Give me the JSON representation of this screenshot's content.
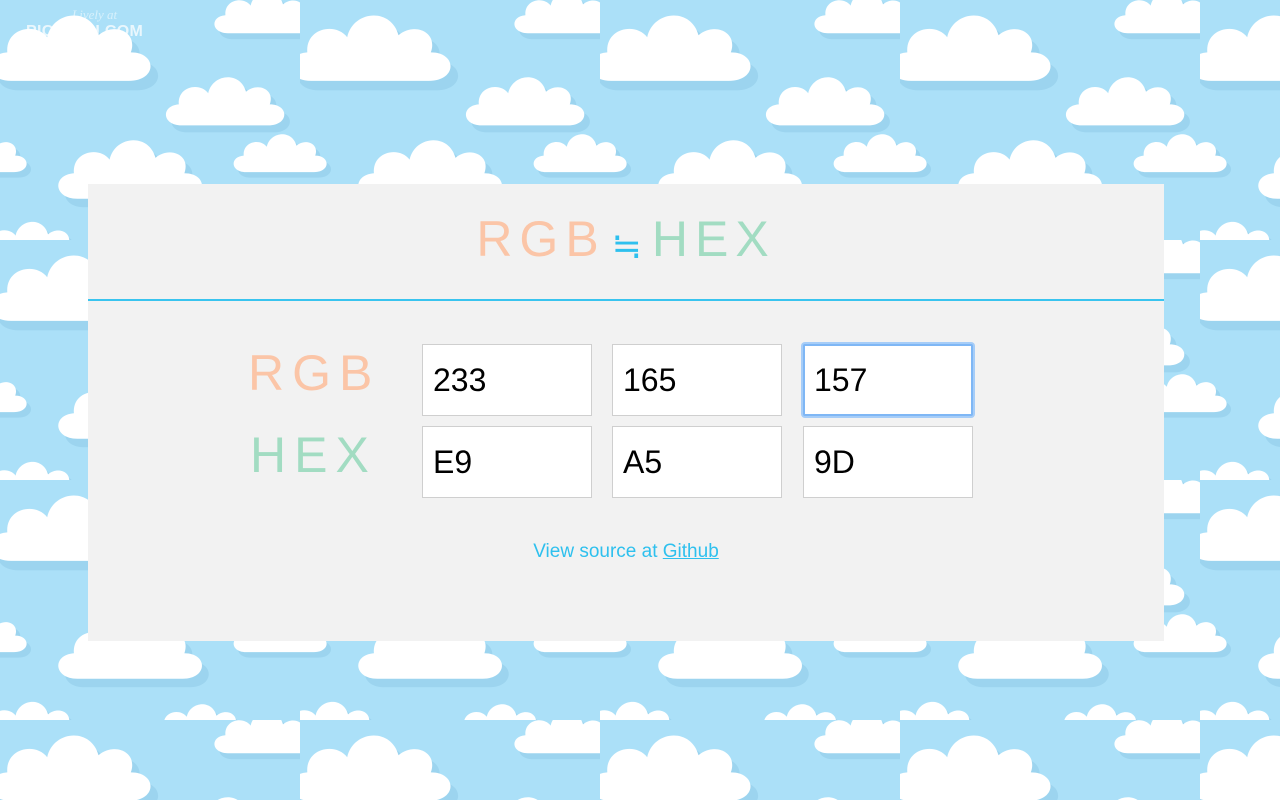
{
  "watermark": {
    "top": "Lively at",
    "bottom": "PICBASH.COM"
  },
  "header": {
    "title_left": "RGB",
    "title_symbol": "≒",
    "title_right": "HEX"
  },
  "form": {
    "rgb_label": "RGB",
    "hex_label": "HEX",
    "rgb": {
      "r": "233",
      "g": "165",
      "b": "157"
    },
    "hex": {
      "r": "E9",
      "g": "A5",
      "b": "9D"
    }
  },
  "footer": {
    "text": "View source at ",
    "link_label": "Github"
  },
  "colors": {
    "background": "#abe0f8",
    "panel": "#f2f2f2",
    "rgb_accent": "#fbc5a7",
    "hex_accent": "#a2dcc2",
    "link": "#2ec0ee"
  }
}
